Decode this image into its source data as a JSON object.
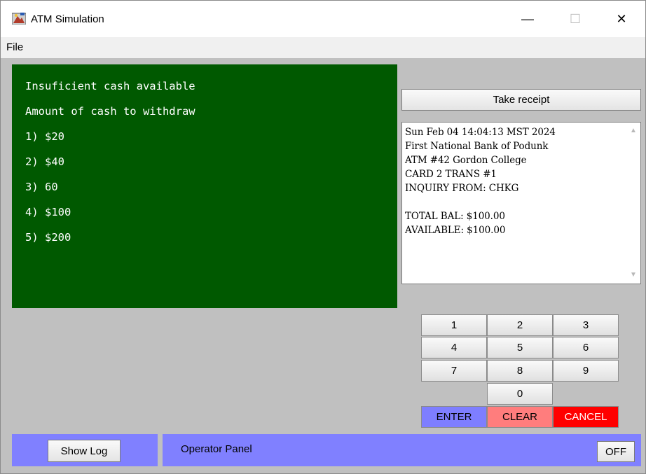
{
  "window": {
    "title": "ATM Simulation",
    "minimize_glyph": "—",
    "maximize_glyph": "☐",
    "close_glyph": "✕"
  },
  "menu": {
    "file": "File"
  },
  "screen": {
    "lines": [
      "Insuficient cash available",
      "Amount of cash to withdraw",
      "1) $20",
      "2) $40",
      "3) 60",
      "4) $100",
      "5) $200"
    ]
  },
  "receipt": {
    "button": "Take receipt",
    "lines": [
      "Sun Feb 04 14:04:13 MST 2024",
      "First National Bank of Podunk",
      "ATM #42 Gordon College",
      "CARD 2 TRANS #1",
      "INQUIRY FROM: CHKG",
      "",
      "TOTAL BAL: $100.00",
      "AVAILABLE: $100.00"
    ]
  },
  "keypad": {
    "keys": [
      "1",
      "2",
      "3",
      "4",
      "5",
      "6",
      "7",
      "8",
      "9",
      "0"
    ],
    "enter": "ENTER",
    "clear": "CLEAR",
    "cancel": "CANCEL"
  },
  "operator": {
    "show_log": "Show Log",
    "label": "Operator Panel",
    "off": "OFF"
  },
  "colors": {
    "screen_bg": "#005900",
    "enter": "#7e7eff",
    "clear": "#ff7d7d",
    "cancel": "#ff0000",
    "operator_panel": "#8080ff"
  },
  "icons": {
    "app": "atm-app-icon",
    "scroll_up": "chevron-up-icon",
    "scroll_down": "chevron-down-icon"
  }
}
